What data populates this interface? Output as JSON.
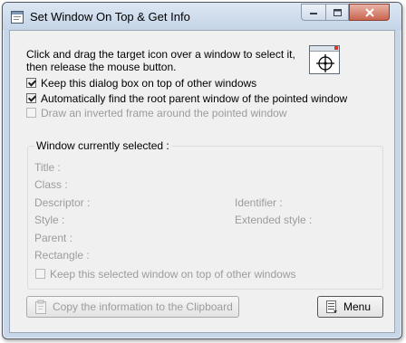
{
  "window": {
    "title": "Set Window On Top & Get Info"
  },
  "instruction": {
    "line1": "Click and drag the target icon over a window to select it,",
    "line2": "then release the mouse button."
  },
  "options": {
    "keep_on_top": {
      "label": "Keep this dialog box on top of other windows",
      "checked": true
    },
    "find_root": {
      "label": "Automatically find the root parent window of the pointed window",
      "checked": true
    },
    "draw_frame": {
      "label": "Draw an inverted frame around the pointed window",
      "checked": false,
      "disabled": true
    }
  },
  "selected": {
    "group_title": "Window currently selected :",
    "title_label": "Title :",
    "class_label": "Class :",
    "descriptor_label": "Descriptor :",
    "identifier_label": "Identifier :",
    "style_label": "Style :",
    "extended_style_label": "Extended style :",
    "parent_label": "Parent :",
    "rectangle_label": "Rectangle :",
    "keep_selected_label": "Keep this selected window on top of other windows"
  },
  "buttons": {
    "copy_label": "Copy the information to the Clipboard",
    "menu_label": "Menu"
  },
  "icons": {
    "app": "window-app-icon",
    "target": "crosshair-target-icon",
    "clipboard": "clipboard-icon",
    "menu": "menu-list-icon"
  }
}
